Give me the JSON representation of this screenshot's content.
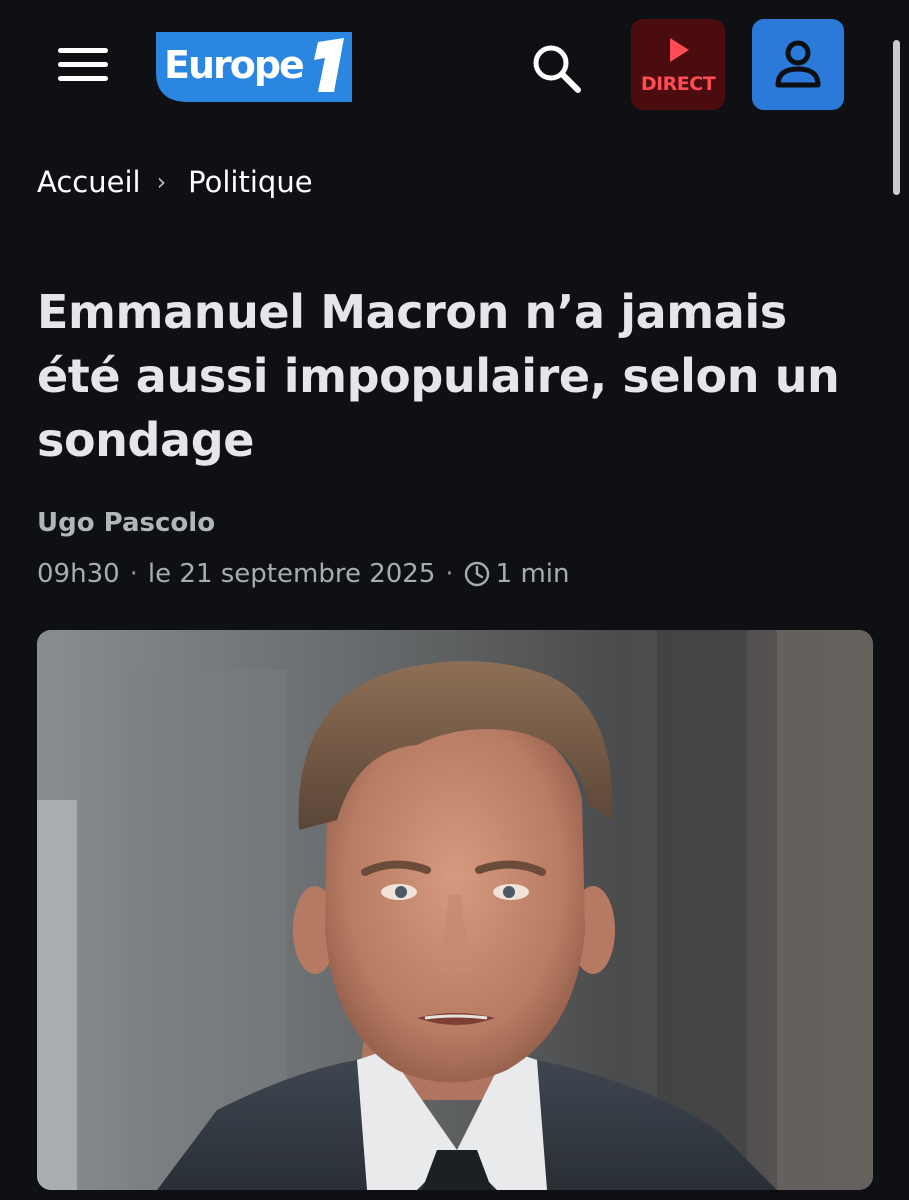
{
  "header": {
    "menu_icon": "hamburger-menu-icon",
    "logo_text": "Europe 1",
    "search_icon": "search-icon",
    "direct_label": "DIRECT",
    "direct_icon": "play-icon",
    "account_icon": "user-icon"
  },
  "breadcrumb": [
    {
      "label": "Accueil"
    },
    {
      "label": "Politique"
    }
  ],
  "article": {
    "title": "Emmanuel Macron n’a jamais été aussi impopulaire, selon un sondage",
    "author": "Ugo Pascolo",
    "time": "09h30",
    "date": "le 21 septembre 2025",
    "reading_time": "1 min",
    "separator": "·"
  },
  "colors": {
    "background": "#0e1014",
    "logo_blue": "#2a86e0",
    "direct_bg": "#4a0c0e",
    "direct_red": "#ff4b53",
    "account_blue": "#2b79d8"
  }
}
